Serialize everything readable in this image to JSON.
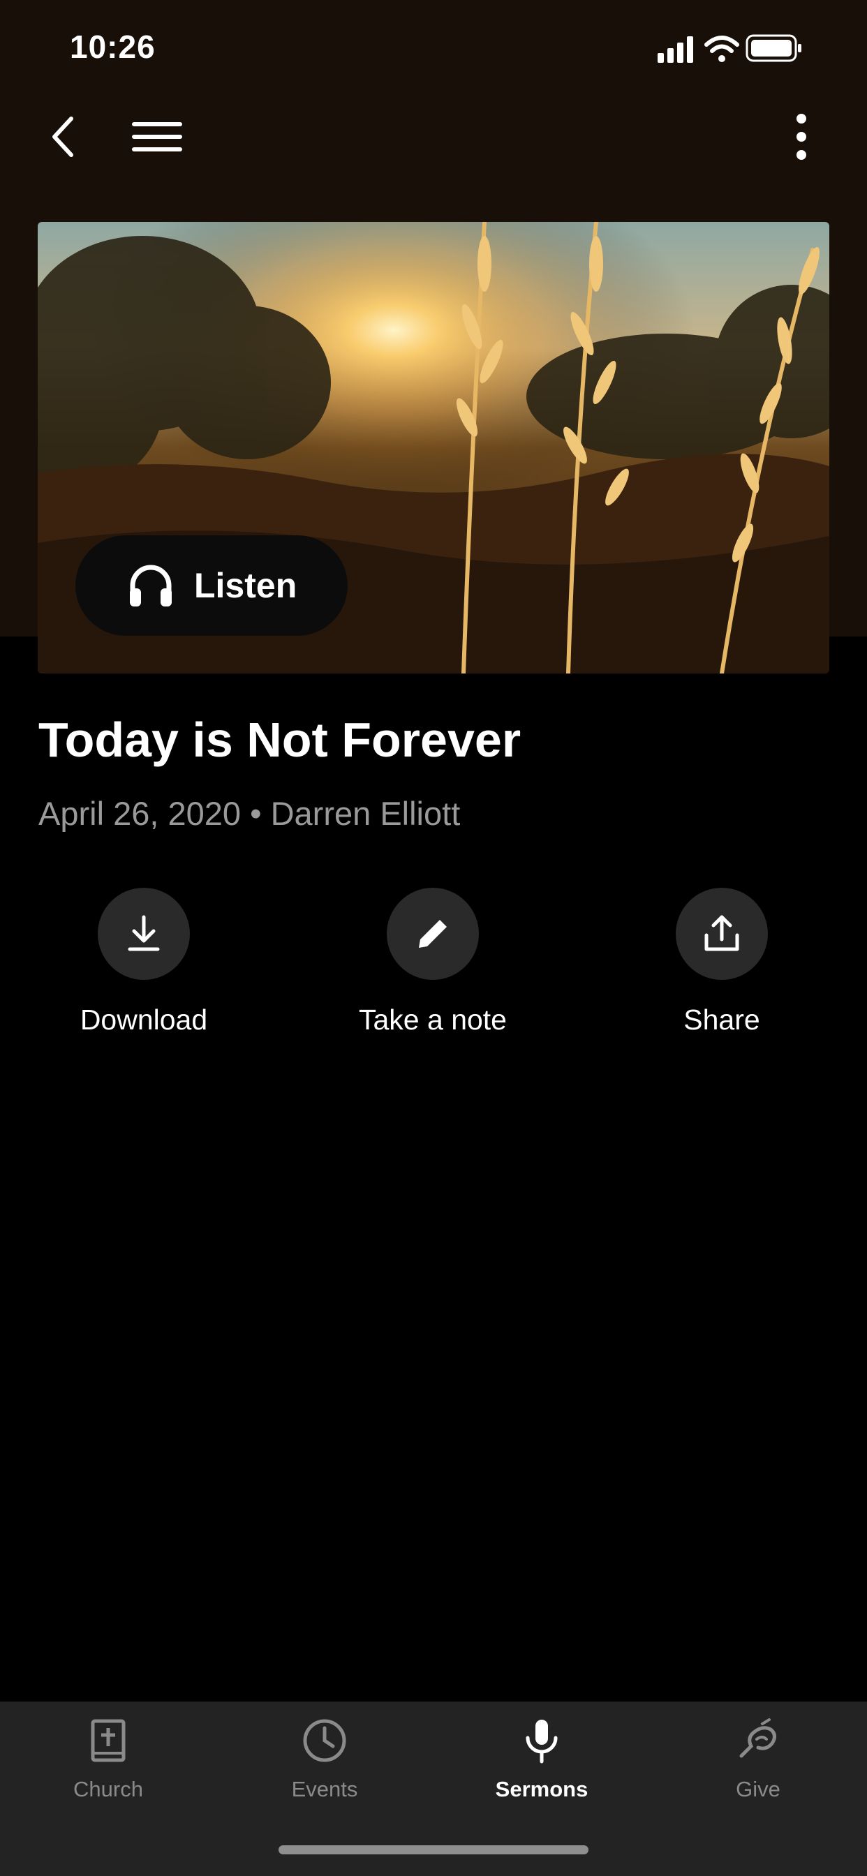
{
  "status_bar": {
    "time": "10:26"
  },
  "nav": {
    "back_icon": "chevron-left-icon",
    "menu_icon": "hamburger-menu-icon",
    "more_icon": "vertical-ellipsis-icon"
  },
  "hero": {
    "image_description": "golden grass stalks at sunset",
    "listen_label": "Listen",
    "listen_icon": "headphones-icon"
  },
  "sermon": {
    "title": "Today is Not Forever",
    "meta": "April 26, 2020 • Darren Elliott"
  },
  "actions": [
    {
      "label": "Download",
      "icon": "download-icon"
    },
    {
      "label": "Take a note",
      "icon": "pencil-icon"
    },
    {
      "label": "Share",
      "icon": "share-icon"
    }
  ],
  "tabs": [
    {
      "label": "Church",
      "icon": "bible-icon",
      "active": false
    },
    {
      "label": "Events",
      "icon": "clock-icon",
      "active": false
    },
    {
      "label": "Sermons",
      "icon": "microphone-icon",
      "active": true
    },
    {
      "label": "Give",
      "icon": "give-icon",
      "active": false
    }
  ],
  "colors": {
    "background": "#000000",
    "header_bg": "#180f08",
    "tab_bar_bg": "#232323",
    "muted_text": "#9a9a9a"
  }
}
